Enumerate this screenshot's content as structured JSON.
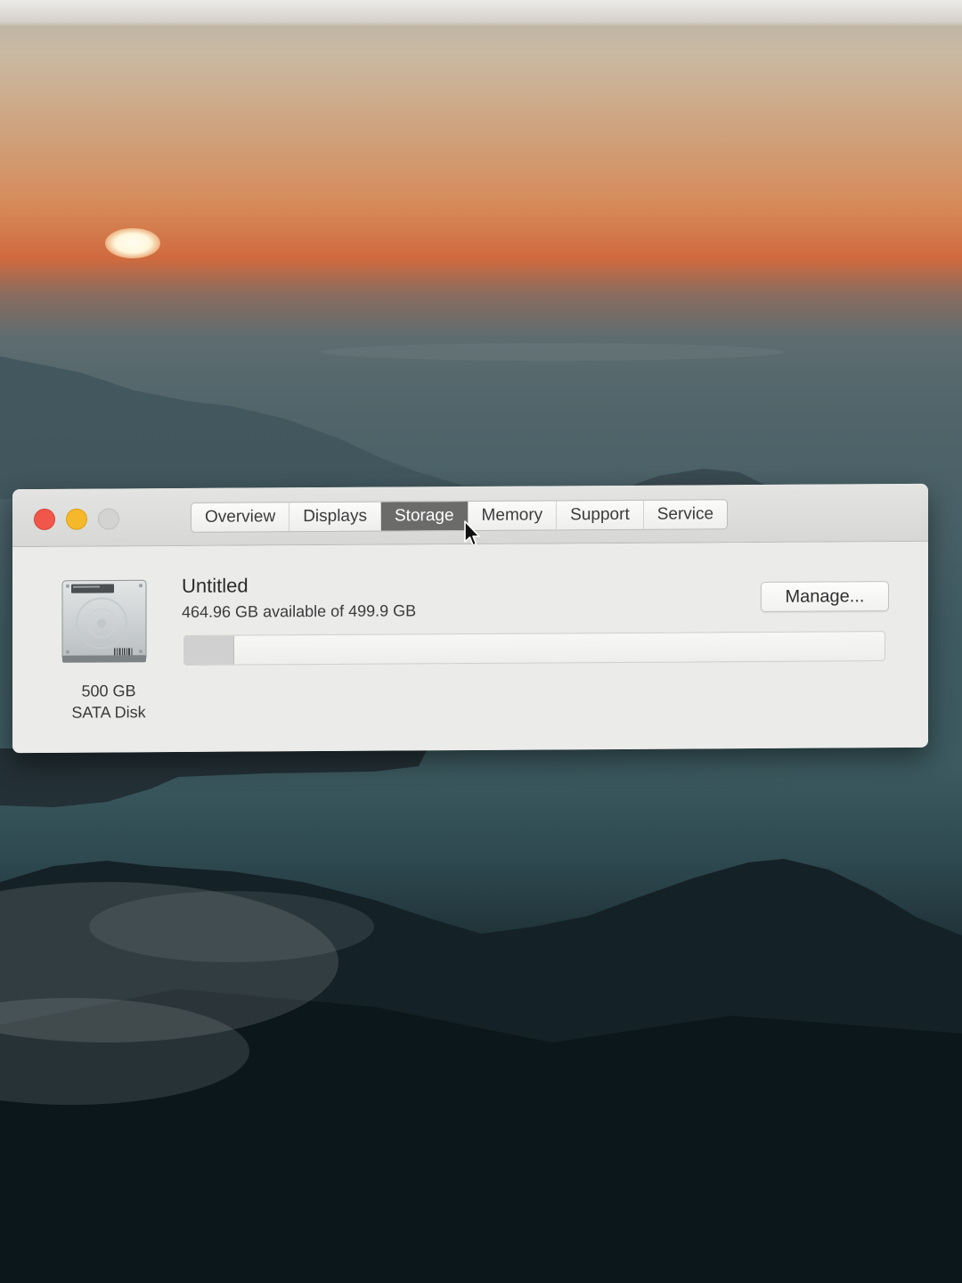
{
  "window": {
    "tabs": [
      {
        "label": "Overview",
        "active": false
      },
      {
        "label": "Displays",
        "active": false
      },
      {
        "label": "Storage",
        "active": true
      },
      {
        "label": "Memory",
        "active": false
      },
      {
        "label": "Support",
        "active": false
      },
      {
        "label": "Service",
        "active": false
      }
    ],
    "traffic_lights": {
      "close_color": "#f0574a",
      "minimize_color": "#f6b82b",
      "zoom_color": "#d3d3d1"
    }
  },
  "storage": {
    "disk_icon": "hard-disk-icon",
    "disk_capacity": "500 GB",
    "disk_type": "SATA Disk",
    "volume_name": "Untitled",
    "volume_stats": "464.96 GB available of 499.9 GB",
    "used_fraction": 0.07,
    "manage_label": "Manage..."
  }
}
